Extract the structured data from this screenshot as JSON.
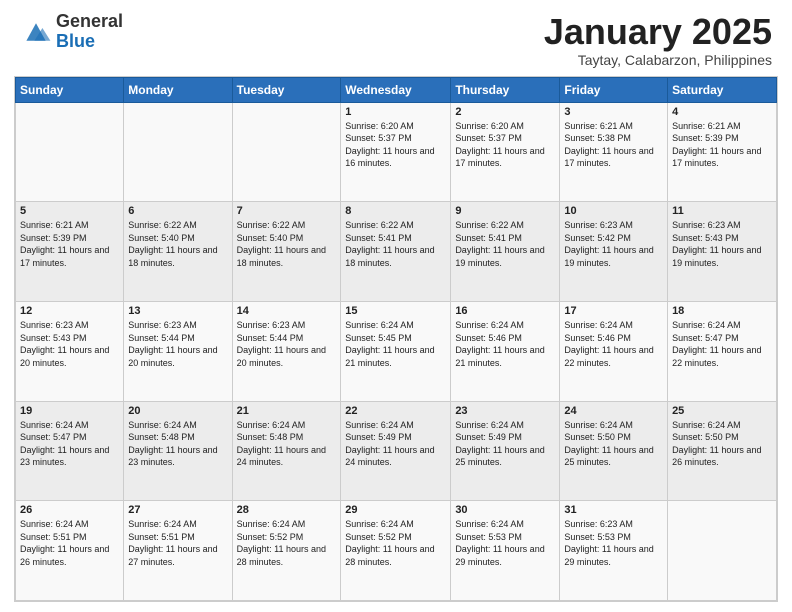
{
  "logo": {
    "general": "General",
    "blue": "Blue"
  },
  "header": {
    "title": "January 2025",
    "subtitle": "Taytay, Calabarzon, Philippines"
  },
  "weekdays": [
    "Sunday",
    "Monday",
    "Tuesday",
    "Wednesday",
    "Thursday",
    "Friday",
    "Saturday"
  ],
  "weeks": [
    [
      {
        "day": "",
        "info": ""
      },
      {
        "day": "",
        "info": ""
      },
      {
        "day": "",
        "info": ""
      },
      {
        "day": "1",
        "info": "Sunrise: 6:20 AM\nSunset: 5:37 PM\nDaylight: 11 hours and 16 minutes."
      },
      {
        "day": "2",
        "info": "Sunrise: 6:20 AM\nSunset: 5:37 PM\nDaylight: 11 hours and 17 minutes."
      },
      {
        "day": "3",
        "info": "Sunrise: 6:21 AM\nSunset: 5:38 PM\nDaylight: 11 hours and 17 minutes."
      },
      {
        "day": "4",
        "info": "Sunrise: 6:21 AM\nSunset: 5:39 PM\nDaylight: 11 hours and 17 minutes."
      }
    ],
    [
      {
        "day": "5",
        "info": "Sunrise: 6:21 AM\nSunset: 5:39 PM\nDaylight: 11 hours and 17 minutes."
      },
      {
        "day": "6",
        "info": "Sunrise: 6:22 AM\nSunset: 5:40 PM\nDaylight: 11 hours and 18 minutes."
      },
      {
        "day": "7",
        "info": "Sunrise: 6:22 AM\nSunset: 5:40 PM\nDaylight: 11 hours and 18 minutes."
      },
      {
        "day": "8",
        "info": "Sunrise: 6:22 AM\nSunset: 5:41 PM\nDaylight: 11 hours and 18 minutes."
      },
      {
        "day": "9",
        "info": "Sunrise: 6:22 AM\nSunset: 5:41 PM\nDaylight: 11 hours and 19 minutes."
      },
      {
        "day": "10",
        "info": "Sunrise: 6:23 AM\nSunset: 5:42 PM\nDaylight: 11 hours and 19 minutes."
      },
      {
        "day": "11",
        "info": "Sunrise: 6:23 AM\nSunset: 5:43 PM\nDaylight: 11 hours and 19 minutes."
      }
    ],
    [
      {
        "day": "12",
        "info": "Sunrise: 6:23 AM\nSunset: 5:43 PM\nDaylight: 11 hours and 20 minutes."
      },
      {
        "day": "13",
        "info": "Sunrise: 6:23 AM\nSunset: 5:44 PM\nDaylight: 11 hours and 20 minutes."
      },
      {
        "day": "14",
        "info": "Sunrise: 6:23 AM\nSunset: 5:44 PM\nDaylight: 11 hours and 20 minutes."
      },
      {
        "day": "15",
        "info": "Sunrise: 6:24 AM\nSunset: 5:45 PM\nDaylight: 11 hours and 21 minutes."
      },
      {
        "day": "16",
        "info": "Sunrise: 6:24 AM\nSunset: 5:46 PM\nDaylight: 11 hours and 21 minutes."
      },
      {
        "day": "17",
        "info": "Sunrise: 6:24 AM\nSunset: 5:46 PM\nDaylight: 11 hours and 22 minutes."
      },
      {
        "day": "18",
        "info": "Sunrise: 6:24 AM\nSunset: 5:47 PM\nDaylight: 11 hours and 22 minutes."
      }
    ],
    [
      {
        "day": "19",
        "info": "Sunrise: 6:24 AM\nSunset: 5:47 PM\nDaylight: 11 hours and 23 minutes."
      },
      {
        "day": "20",
        "info": "Sunrise: 6:24 AM\nSunset: 5:48 PM\nDaylight: 11 hours and 23 minutes."
      },
      {
        "day": "21",
        "info": "Sunrise: 6:24 AM\nSunset: 5:48 PM\nDaylight: 11 hours and 24 minutes."
      },
      {
        "day": "22",
        "info": "Sunrise: 6:24 AM\nSunset: 5:49 PM\nDaylight: 11 hours and 24 minutes."
      },
      {
        "day": "23",
        "info": "Sunrise: 6:24 AM\nSunset: 5:49 PM\nDaylight: 11 hours and 25 minutes."
      },
      {
        "day": "24",
        "info": "Sunrise: 6:24 AM\nSunset: 5:50 PM\nDaylight: 11 hours and 25 minutes."
      },
      {
        "day": "25",
        "info": "Sunrise: 6:24 AM\nSunset: 5:50 PM\nDaylight: 11 hours and 26 minutes."
      }
    ],
    [
      {
        "day": "26",
        "info": "Sunrise: 6:24 AM\nSunset: 5:51 PM\nDaylight: 11 hours and 26 minutes."
      },
      {
        "day": "27",
        "info": "Sunrise: 6:24 AM\nSunset: 5:51 PM\nDaylight: 11 hours and 27 minutes."
      },
      {
        "day": "28",
        "info": "Sunrise: 6:24 AM\nSunset: 5:52 PM\nDaylight: 11 hours and 28 minutes."
      },
      {
        "day": "29",
        "info": "Sunrise: 6:24 AM\nSunset: 5:52 PM\nDaylight: 11 hours and 28 minutes."
      },
      {
        "day": "30",
        "info": "Sunrise: 6:24 AM\nSunset: 5:53 PM\nDaylight: 11 hours and 29 minutes."
      },
      {
        "day": "31",
        "info": "Sunrise: 6:23 AM\nSunset: 5:53 PM\nDaylight: 11 hours and 29 minutes."
      },
      {
        "day": "",
        "info": ""
      }
    ]
  ]
}
